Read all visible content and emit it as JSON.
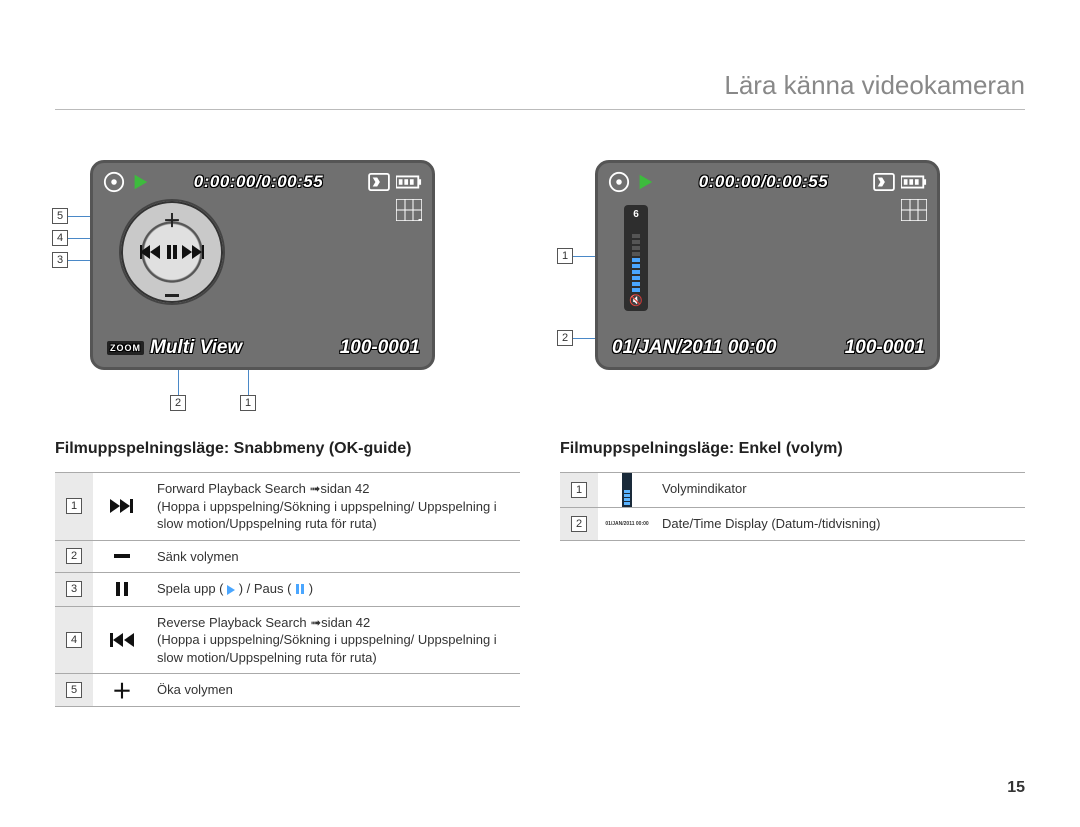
{
  "header": {
    "title": "Lära känna videokameran"
  },
  "page_number": "15",
  "screenA": {
    "timecode": "0:00:00/0:00:55",
    "bottom_left_prefix": "ZOOM",
    "bottom_left_label": "Multi View",
    "file_number": "100-0001",
    "callouts": {
      "c1": "5",
      "c2": "4",
      "c3": "3",
      "c4": "2",
      "c5": "1"
    }
  },
  "screenB": {
    "timecode": "0:00:00/0:00:55",
    "datetime": "01/JAN/2011 00:00",
    "file_number": "100-0001",
    "volume_level": "6",
    "callouts": {
      "c1": "1",
      "c2": "2"
    }
  },
  "sectionA": {
    "title": "Filmuppspelningsläge: Snabbmeny (OK-guide)",
    "rows": [
      {
        "n": "1",
        "icon": "ffwd",
        "text": "Forward Playback Search ",
        "ref": "sidan 42",
        "sub": "(Hoppa i uppspelning/Sökning i uppspelning/\nUppspelning i slow motion/Uppspelning ruta för ruta)"
      },
      {
        "n": "2",
        "icon": "minus",
        "text": "Sänk volymen"
      },
      {
        "n": "3",
        "icon": "pause",
        "text": "Spela upp ( ▶ ) / Paus ( ❚❚ )"
      },
      {
        "n": "4",
        "icon": "rew",
        "text": "Reverse Playback Search ",
        "ref": "sidan 42",
        "sub": "(Hoppa i uppspelning/Sökning i uppspelning/\nUppspelning i slow motion/Uppspelning ruta för ruta)"
      },
      {
        "n": "5",
        "icon": "plus",
        "text": "Öka volymen"
      }
    ]
  },
  "sectionB": {
    "title": "Filmuppspelningsläge: Enkel (volym)",
    "rows": [
      {
        "n": "1",
        "icon": "vol",
        "text": "Volymindikator"
      },
      {
        "n": "2",
        "icon": "dt",
        "text": "Date/Time Display (Datum-/tidvisning)",
        "mini": "01/JAN/2011 00:00"
      }
    ]
  }
}
